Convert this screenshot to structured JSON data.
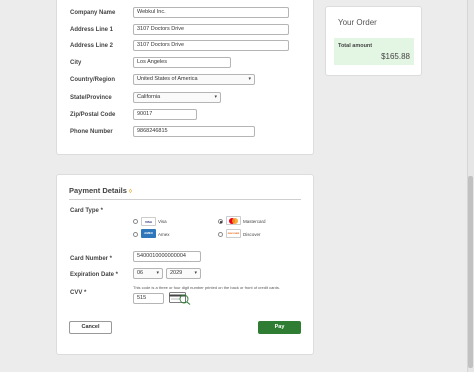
{
  "address_form": {
    "company_name": {
      "label": "Company Name",
      "value": "Webkul Inc."
    },
    "address_line_1": {
      "label": "Address Line 1",
      "value": "3107  Doctors Drive"
    },
    "address_line_2": {
      "label": "Address Line 2",
      "value": "3107  Doctors Drive"
    },
    "city": {
      "label": "City",
      "value": "Los Angeles"
    },
    "country": {
      "label": "Country/Region",
      "value": "United States of America"
    },
    "state": {
      "label": "State/Province",
      "value": "California"
    },
    "zip": {
      "label": "Zip/Postal Code",
      "value": "90017"
    },
    "phone": {
      "label": "Phone Number",
      "value": "9868246815"
    }
  },
  "order_summary": {
    "title": "Your Order",
    "total_label": "Total amount",
    "total_value": "$165.88",
    "highlight_color": "#e3f5e3"
  },
  "payment": {
    "title": "Payment Details",
    "card_type_label": "Card Type *",
    "card_types": [
      {
        "name": "Visa",
        "logo_text": "VISA",
        "selected": false
      },
      {
        "name": "Mastercard",
        "logo_text": "MC",
        "selected": true
      },
      {
        "name": "Amex",
        "logo_text": "AMEX",
        "selected": false
      },
      {
        "name": "Discover",
        "logo_text": "DISCOVER",
        "selected": false
      }
    ],
    "card_number_label": "Card Number *",
    "card_number_value": "5400010000000004",
    "expiration_label": "Expiration Date *",
    "expiration_month": "06",
    "expiration_year": "2029",
    "cvv_label": "CVV *",
    "cvv_hint": "This code is a three or four digit number printed on the back or front of credit cards.",
    "cvv_value": "515",
    "cancel_label": "Cancel",
    "pay_label": "Pay",
    "pay_color": "#2e7d32"
  }
}
